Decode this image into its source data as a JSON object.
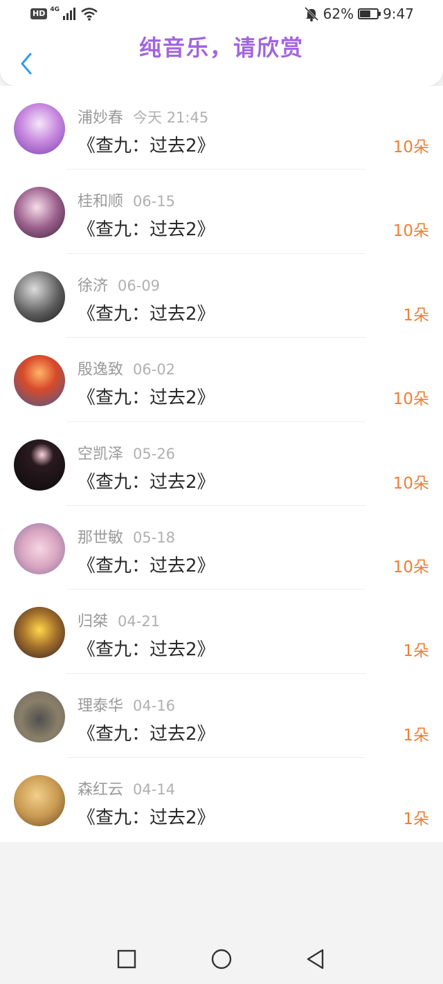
{
  "status_bar": {
    "hd": "HD",
    "network": "4G",
    "battery": "62%",
    "battery_level": 0.62,
    "time": "9:47",
    "icons": [
      "signal-icon",
      "wifi-icon",
      "bell-muted-icon",
      "battery-icon"
    ]
  },
  "header": {
    "title": "纯音乐，请欣赏",
    "title_color": "#a265de",
    "back_icon": "chevron-left-icon",
    "back_color": "#2f9bf0"
  },
  "accent": {
    "gift_color": "#ee7e35"
  },
  "list": [
    {
      "name": "浦妙春",
      "time": "今天 21:45",
      "song": "《查九：过去2》",
      "gift": "10朵"
    },
    {
      "name": "桂和顺",
      "time": "06-15",
      "song": "《查九：过去2》",
      "gift": "10朵"
    },
    {
      "name": "徐济",
      "time": "06-09",
      "song": "《查九：过去2》",
      "gift": "1朵"
    },
    {
      "name": "殷逸致",
      "time": "06-02",
      "song": "《查九：过去2》",
      "gift": "10朵"
    },
    {
      "name": "空凯泽",
      "time": "05-26",
      "song": "《查九：过去2》",
      "gift": "10朵"
    },
    {
      "name": "那世敏",
      "time": "05-18",
      "song": "《查九：过去2》",
      "gift": "10朵"
    },
    {
      "name": "归桀",
      "time": "04-21",
      "song": "《查九：过去2》",
      "gift": "1朵"
    },
    {
      "name": "理泰华",
      "time": "04-16",
      "song": "《查九：过去2》",
      "gift": "1朵"
    },
    {
      "name": "森红云",
      "time": "04-14",
      "song": "《查九：过去2》",
      "gift": "1朵"
    }
  ],
  "bottom_nav": [
    "recent-apps-icon",
    "home-icon",
    "back-triangle-icon"
  ]
}
